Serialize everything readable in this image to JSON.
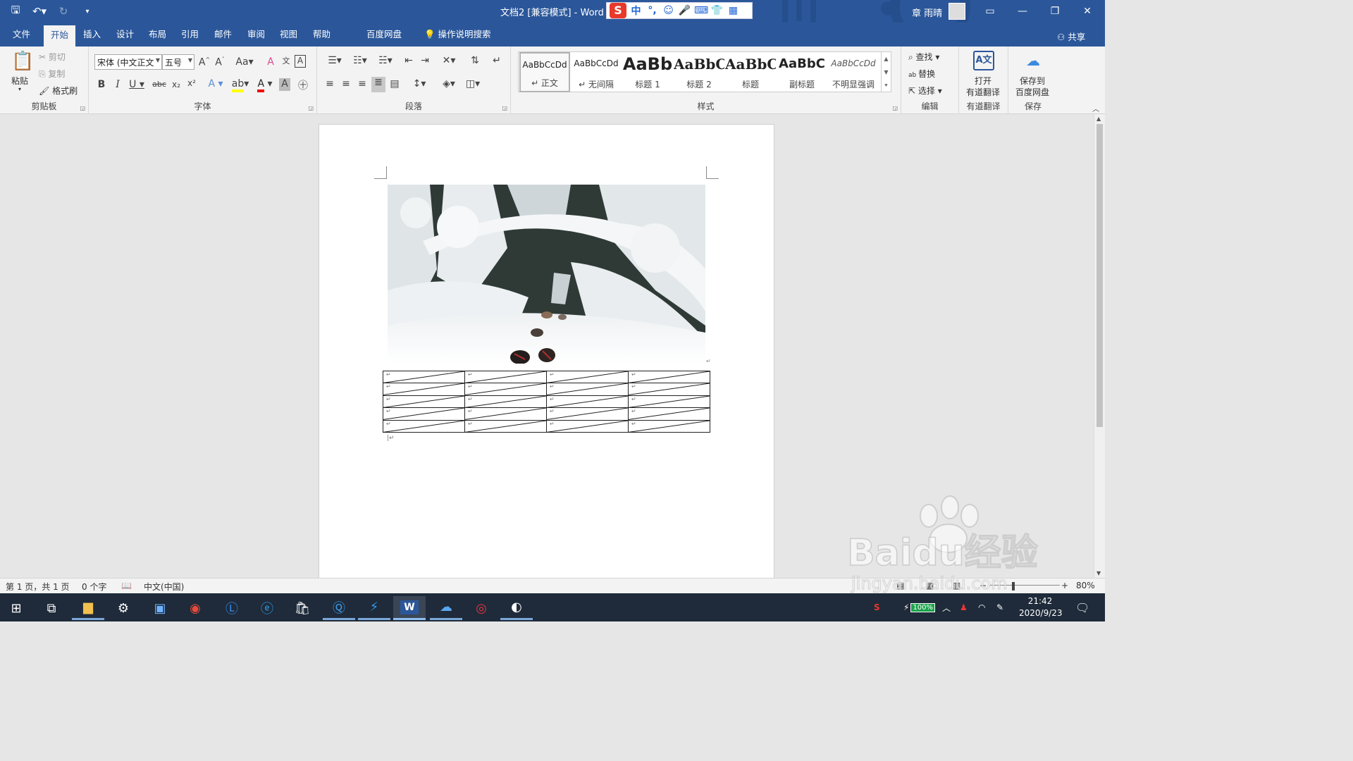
{
  "titlebar": {
    "document_title": "文档2 [兼容模式]  -  Word",
    "user_name": "章 雨晴",
    "ime_items": [
      "中",
      "°,",
      "☺",
      "🎤",
      "⌨",
      "👕",
      "▦"
    ]
  },
  "tabs": [
    {
      "label": "文件"
    },
    {
      "label": "开始"
    },
    {
      "label": "插入"
    },
    {
      "label": "设计"
    },
    {
      "label": "布局"
    },
    {
      "label": "引用"
    },
    {
      "label": "邮件"
    },
    {
      "label": "审阅"
    },
    {
      "label": "视图"
    },
    {
      "label": "帮助"
    },
    {
      "label": "百度网盘"
    }
  ],
  "search_label": "操作说明搜索",
  "share_label": "共享",
  "ribbon": {
    "clipboard": {
      "paste": "粘贴",
      "cut": "剪切",
      "copy": "复制",
      "format_painter": "格式刷",
      "label": "剪贴板"
    },
    "font": {
      "font_name": "宋体 (中文正文",
      "font_size": "五号",
      "label": "字体"
    },
    "paragraph": {
      "label": "段落"
    },
    "styles": {
      "label": "样式",
      "items": [
        {
          "preview": "AaBbCcDd",
          "name": "↵ 正文"
        },
        {
          "preview": "AaBbCcDd",
          "name": "↵ 无间隔"
        },
        {
          "preview": "AaBb",
          "name": "标题 1"
        },
        {
          "preview": "AaBbC",
          "name": "标题 2"
        },
        {
          "preview": "AaBbC",
          "name": "标题"
        },
        {
          "preview": "AaBbC",
          "name": "副标题"
        },
        {
          "preview": "AaBbCcDd",
          "name": "不明显强调"
        }
      ]
    },
    "editing": {
      "find": "查找",
      "replace": "替换",
      "select": "选择",
      "label": "编辑"
    },
    "youdao": {
      "open": "打开",
      "translate": "有道翻译",
      "label": "有道翻译"
    },
    "save": {
      "line1": "保存到",
      "line2": "百度网盘",
      "label": "保存"
    }
  },
  "document": {
    "table": {
      "rows": 5,
      "cols": 4,
      "cell_mark": "↵"
    }
  },
  "statusbar": {
    "page": "第 1 页，共 1 页",
    "words": "0 个字",
    "language": "中文(中国)",
    "zoom": "80%"
  },
  "taskbar": {
    "battery": "100%",
    "time": "21:42",
    "date": "2020/9/23"
  },
  "watermark": {
    "brand": "Baidu经验",
    "url": "jingyan.baidu.com"
  },
  "colors": {
    "word_blue": "#2b579a",
    "taskbar": "#1f2b3a",
    "ribbon": "#f3f3f3"
  }
}
